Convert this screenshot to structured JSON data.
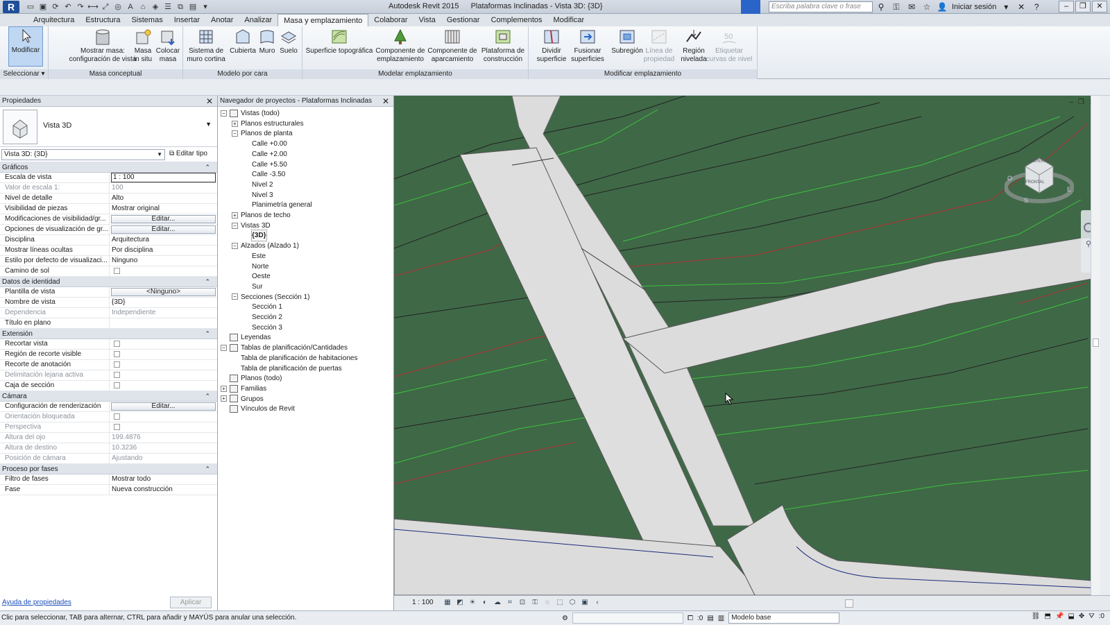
{
  "app": {
    "product": "Autodesk Revit 2015",
    "document_title": "Plataformas Inclinadas - Vista 3D: {3D}",
    "help_search_placeholder": "Escriba palabra clave o frase",
    "sign_in": "Iniciar sesión"
  },
  "ribbon_tabs": [
    "Arquitectura",
    "Estructura",
    "Sistemas",
    "Insertar",
    "Anotar",
    "Analizar",
    "Masa y emplazamiento",
    "Colaborar",
    "Vista",
    "Gestionar",
    "Complementos",
    "Modificar"
  ],
  "active_tab": "Masa y emplazamiento",
  "ribbon": {
    "select": {
      "modify": "Modificar",
      "label": "Seleccionar"
    },
    "conceptual_mass": {
      "label": "Masa conceptual",
      "show_mass_l1": "Mostrar masa:",
      "show_mass_l2": "configuración de vista",
      "inplace_l1": "Masa",
      "inplace_l2": "in situ",
      "place_l1": "Colocar",
      "place_l2": "masa"
    },
    "model_by_face": {
      "label": "Modelo por cara",
      "curtain_l1": "Sistema de",
      "curtain_l2": "muro cortina",
      "roof": "Cubierta",
      "wall": "Muro",
      "floor": "Suelo"
    },
    "model_site": {
      "label": "Modelar emplazamiento",
      "toposurface": "Superficie topográfica",
      "site_comp_l1": "Componente de",
      "site_comp_l2": "emplazamiento",
      "parking_l1": "Componente de",
      "parking_l2": "aparcamiento",
      "pad_l1": "Plataforma de",
      "pad_l2": "construcción"
    },
    "modify_site": {
      "label": "Modificar emplazamiento",
      "split_l1": "Dividir",
      "split_l2": "superficie",
      "merge_l1": "Fusionar",
      "merge_l2": "superficies",
      "subregion": "Subregión",
      "property_line_l1": "Línea de",
      "property_line_l2": "propiedad",
      "graded_l1": "Región",
      "graded_l2": "nivelada",
      "contour_l1": "Etiquetar",
      "contour_l2": "curvas de nivel"
    }
  },
  "properties": {
    "title": "Propiedades",
    "type_name": "Vista 3D",
    "instance_selector": "Vista 3D: {3D}",
    "edit_type": "Editar tipo",
    "sections": [
      {
        "name": "Gráficos",
        "rows": [
          {
            "k": "Escala de vista",
            "v": "1 : 100",
            "kind": "input"
          },
          {
            "k": "Valor de escala    1:",
            "v": "100",
            "gray": true
          },
          {
            "k": "Nivel de detalle",
            "v": "Alto"
          },
          {
            "k": "Visibilidad de piezas",
            "v": "Mostrar original"
          },
          {
            "k": "Modificaciones de visibilidad/gr...",
            "v": "Editar...",
            "kind": "button"
          },
          {
            "k": "Opciones de visualización de gr...",
            "v": "Editar...",
            "kind": "button"
          },
          {
            "k": "Disciplina",
            "v": "Arquitectura"
          },
          {
            "k": "Mostrar líneas ocultas",
            "v": "Por disciplina"
          },
          {
            "k": "Estilo por defecto de visualizaci...",
            "v": "Ninguno"
          },
          {
            "k": "Camino de sol",
            "v": "",
            "kind": "check"
          }
        ]
      },
      {
        "name": "Datos de identidad",
        "rows": [
          {
            "k": "Plantilla de vista",
            "v": "<Ninguno>",
            "kind": "button"
          },
          {
            "k": "Nombre de vista",
            "v": "{3D}"
          },
          {
            "k": "Dependencia",
            "v": "Independiente",
            "gray": true
          },
          {
            "k": "Título en plano",
            "v": ""
          }
        ]
      },
      {
        "name": "Extensión",
        "rows": [
          {
            "k": "Recortar vista",
            "v": "",
            "kind": "check"
          },
          {
            "k": "Región de recorte visible",
            "v": "",
            "kind": "check"
          },
          {
            "k": "Recorte de anotación",
            "v": "",
            "kind": "check"
          },
          {
            "k": "Delimitación lejana activa",
            "v": "",
            "kind": "check",
            "gray": true
          },
          {
            "k": "Caja de sección",
            "v": "",
            "kind": "check"
          }
        ]
      },
      {
        "name": "Cámara",
        "rows": [
          {
            "k": "Configuración de renderización",
            "v": "Editar...",
            "kind": "button"
          },
          {
            "k": "Orientación bloqueada",
            "v": "",
            "kind": "check",
            "gray": true
          },
          {
            "k": "Perspectiva",
            "v": "",
            "kind": "check",
            "gray": true
          },
          {
            "k": "Altura del ojo",
            "v": "199.4876",
            "gray": true
          },
          {
            "k": "Altura de destino",
            "v": "10.3236",
            "gray": true
          },
          {
            "k": "Posición de cámara",
            "v": "Ajustando",
            "gray": true
          }
        ]
      },
      {
        "name": "Proceso por fases",
        "rows": [
          {
            "k": "Filtro de fases",
            "v": "Mostrar todo"
          },
          {
            "k": "Fase",
            "v": "Nueva construcción"
          }
        ]
      }
    ],
    "help_link": "Ayuda de propiedades",
    "apply": "Aplicar"
  },
  "browser": {
    "title": "Navegador de proyectos - Plataformas Inclinadas",
    "nodes": [
      {
        "label": "Vistas (todo)",
        "level": 0,
        "exp": "−",
        "icon": true
      },
      {
        "label": "Planos estructurales",
        "level": 1,
        "exp": "+"
      },
      {
        "label": "Planos de planta",
        "level": 1,
        "exp": "−"
      },
      {
        "label": "Calle +0.00",
        "level": 2
      },
      {
        "label": "Calle +2.00",
        "level": 2
      },
      {
        "label": "Calle +5.50",
        "level": 2
      },
      {
        "label": "Calle -3.50",
        "level": 2
      },
      {
        "label": "Nivel 2",
        "level": 2
      },
      {
        "label": "Nivel 3",
        "level": 2
      },
      {
        "label": "Planimetría general",
        "level": 2
      },
      {
        "label": "Planos de techo",
        "level": 1,
        "exp": "+"
      },
      {
        "label": "Vistas 3D",
        "level": 1,
        "exp": "−"
      },
      {
        "label": "{3D}",
        "level": 2,
        "bold": true
      },
      {
        "label": "Alzados (Alzado 1)",
        "level": 1,
        "exp": "−"
      },
      {
        "label": "Este",
        "level": 2
      },
      {
        "label": "Norte",
        "level": 2
      },
      {
        "label": "Oeste",
        "level": 2
      },
      {
        "label": "Sur",
        "level": 2
      },
      {
        "label": "Secciones (Sección 1)",
        "level": 1,
        "exp": "−"
      },
      {
        "label": "Sección 1",
        "level": 2
      },
      {
        "label": "Sección 2",
        "level": 2
      },
      {
        "label": "Sección 3",
        "level": 2
      },
      {
        "label": "Leyendas",
        "level": 0,
        "icon": true
      },
      {
        "label": "Tablas de planificación/Cantidades",
        "level": 0,
        "exp": "−",
        "icon": true
      },
      {
        "label": "Tabla de planificación de habitaciones",
        "level": 1
      },
      {
        "label": "Tabla de planificación de puertas",
        "level": 1
      },
      {
        "label": "Planos (todo)",
        "level": 0,
        "icon": true
      },
      {
        "label": "Familias",
        "level": 0,
        "exp": "+",
        "icon": true
      },
      {
        "label": "Grupos",
        "level": 0,
        "exp": "+",
        "icon": true
      },
      {
        "label": "Vínculos de Revit",
        "level": 0,
        "icon": true
      }
    ]
  },
  "view": {
    "viewcube_top": "SUPERIOR",
    "viewcube_front": "FRONTAL",
    "compass_s": "S",
    "compass_e": "E",
    "compass_o": "O",
    "scale": "1 : 100"
  },
  "status": {
    "message": "Clic para seleccionar, TAB para alternar, CTRL para añadir y MAYÚS para anular una selección.",
    "worksets": ":0",
    "design_option": "Modelo base",
    "filter": ":0"
  },
  "colors": {
    "terrain": "#3f6847",
    "road": "#dedede",
    "contour_red": "#b03030",
    "contour_green": "#3cc43c",
    "accent_blue": "#2b64c8"
  }
}
